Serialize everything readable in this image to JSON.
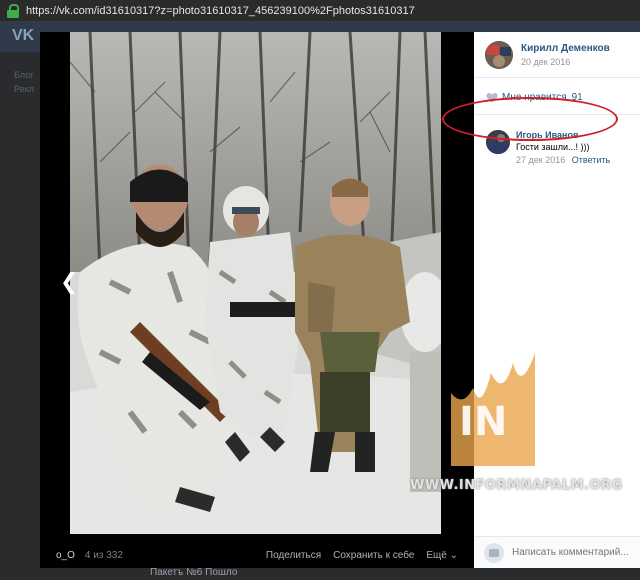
{
  "browser": {
    "url": "https://vk.com/id31610317?z=photo31610317_456239100%2Fphotos31610317"
  },
  "background": {
    "logo": "VK",
    "left_links": [
      "Блог",
      "Рекл"
    ],
    "bottom_text": "Пакетъ №6 Пошло"
  },
  "viewer": {
    "owner_short": "o_O",
    "counter": "4 из 332",
    "share_label": "Поделиться",
    "save_label": "Сохранить к себе",
    "more_label": "Ещё ⌄",
    "prev_icon": "chevron-left-icon"
  },
  "side": {
    "author_name": "Кирилл Деменков",
    "author_date": "20 дек 2016",
    "like_label": "Мне нравится",
    "like_count": "91",
    "comment": {
      "name": "Игорь Иванов",
      "text": "Гости зашли...! )))",
      "date": "27 дек 2016",
      "reply_label": "Ответить"
    },
    "comment_placeholder": "Написать комментарий...",
    "accent": "#2a5885",
    "highlight": "#d21f28"
  },
  "watermark": {
    "logo": "IN",
    "text": "WWW.INFORMNAPALM.ORG"
  }
}
